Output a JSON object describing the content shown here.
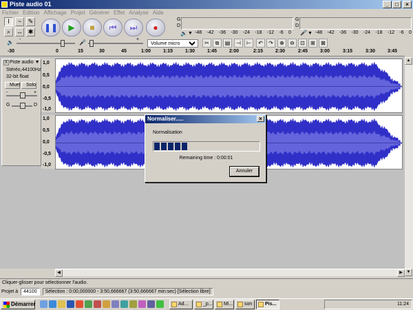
{
  "window": {
    "title": "Piste audio 01"
  },
  "menu": [
    "Fichier",
    "Edition",
    "Affichage",
    "Projet",
    "Générer",
    "Effet",
    "Analyse",
    "Aide"
  ],
  "meters": {
    "play_scale": [
      "-48",
      "-42",
      "-36",
      "-30",
      "-24",
      "-18",
      "-12",
      "-6",
      "0"
    ],
    "rec_scale": [
      "-48",
      "-42",
      "-36",
      "-30",
      "-24",
      "-18",
      "-12",
      "-6",
      "0"
    ],
    "L": "G",
    "R": "D"
  },
  "mixer": {
    "source": "Volume micro",
    "slider_minus": "-",
    "slider_plus": "+"
  },
  "ruler": [
    "-30",
    "0",
    "15",
    "30",
    "45",
    "1:00",
    "1:15",
    "1:30",
    "1:45",
    "2:00",
    "2:15",
    "2:30",
    "2:45",
    "3:00",
    "3:15",
    "3:30",
    "3:45"
  ],
  "track": {
    "close": "X",
    "name": "Piste audio",
    "format": "Stéréo,44100Hz",
    "bits": "32-bit float",
    "mute": "Muet",
    "solo": "Solo",
    "gain_minus": "-",
    "gain_plus": "+",
    "pan_left": "G",
    "pan_right": "D",
    "scale": [
      "1,0",
      "0,5",
      "0,0",
      "-0,5",
      "-1,0"
    ]
  },
  "dialog": {
    "title": "Normaliser.....",
    "message": "Normalisation",
    "progress": 0.33,
    "remaining": "Remaining time : 0:00:01",
    "cancel": "Annuler",
    "close": "×"
  },
  "status": {
    "hint": "Cliquer-glisser pour sélectionner l'audio.",
    "project_label": "Projet à",
    "rate": "44100",
    "selection": "Sélection : 0:00,000000 - 3:50,666667 (3:50,666667 min:sec)   [Sélection libre]"
  },
  "taskbar": {
    "start": "Démarrer",
    "tasks": [
      "Ad...",
      "_p...",
      "Mi...",
      "son",
      "Pis..."
    ],
    "clock": "11:24"
  },
  "colors": {
    "wave": "#3030c8",
    "wave_rms": "#6464dc",
    "wave_bg": "#ffffff"
  }
}
